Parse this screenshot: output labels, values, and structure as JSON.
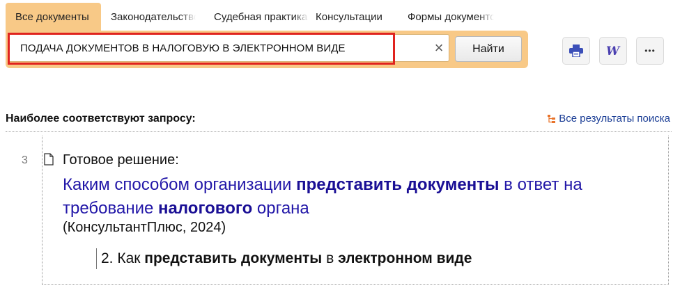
{
  "tabs": [
    {
      "label": "Все документы",
      "active": true
    },
    {
      "label": "Законодательство"
    },
    {
      "label": "Судебная практика"
    },
    {
      "label": "Консультации"
    },
    {
      "label": "Формы документов"
    }
  ],
  "search": {
    "query": "ПОДАЧА ДОКУМЕНТОВ В НАЛОГОВУЮ В ЭЛЕКТРОННОМ ВИДЕ",
    "clear_symbol": "×",
    "find_label": "Найти"
  },
  "toolbar": {
    "print_icon": "printer-icon",
    "word_icon": "word-export-icon",
    "more_label": "•••"
  },
  "results": {
    "title": "Наиболее соответствуют запросу:",
    "all_results_label": "Все результаты поиска",
    "items": [
      {
        "index": "3",
        "kind": "Готовое решение:",
        "link_parts": [
          {
            "text": "Каким способом организации ",
            "bold": false
          },
          {
            "text": "представить документы",
            "bold": true
          },
          {
            "text": " в ответ на требование ",
            "bold": false
          },
          {
            "text": "налогового",
            "bold": true
          },
          {
            "text": " органа",
            "bold": false
          }
        ],
        "source": "(КонсультантПлюс, 2024)",
        "fragment_parts": [
          {
            "text": "2. Как ",
            "bold": false
          },
          {
            "text": "представить документы",
            "bold": true
          },
          {
            "text": " в ",
            "bold": false
          },
          {
            "text": "электронном виде",
            "bold": true
          }
        ]
      }
    ]
  },
  "colors": {
    "tab_active": "#f8c987",
    "highlight_border": "#e0231e",
    "link": "#2217a8"
  }
}
